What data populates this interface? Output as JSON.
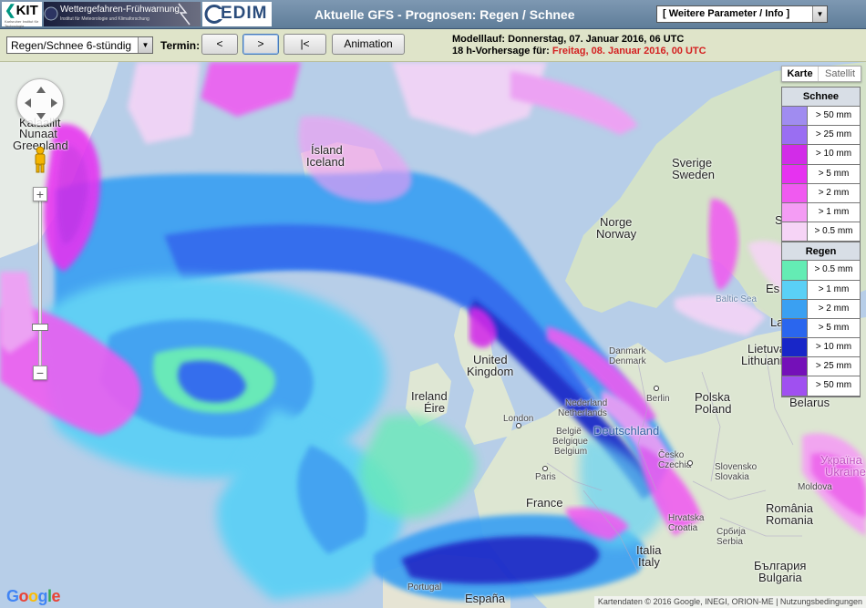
{
  "header": {
    "logo_kit": "KIT",
    "logo_kit_sub": "Karlsruher Institut für Technologie",
    "logo_wett_title": "Wettergefahren-Frühwarnung",
    "logo_wett_sub": "Institut für Meteorologie und Klimaforschung",
    "logo_cedim": "EDIM",
    "title": "Aktuelle GFS - Prognosen: Regen / Schnee",
    "param_select": "[ Weitere Parameter / Info ]"
  },
  "toolbar": {
    "product_select": "Regen/Schnee 6-stündig",
    "termin_label": "Termin:",
    "prev_label": "<",
    "next_label": ">",
    "first_label": "|<",
    "animation_label": "Animation",
    "run_line": "Modelllauf: Donnerstag, 07. Januar 2016, 06 UTC",
    "forecast_prefix": "18 h-Vorhersage für:",
    "forecast_time": "Freitag, 08. Januar 2016, 00 UTC"
  },
  "map": {
    "maptype_karte": "Karte",
    "maptype_satellit": "Satellit",
    "labels": {
      "kalaallit": "Kalaallit",
      "nunaat": "Nunaat",
      "greenland": "Greenland",
      "island": "Ísland",
      "iceland": "Iceland",
      "sverige": "Sverige",
      "sweden": "Sweden",
      "norge": "Norge",
      "norway": "Norway",
      "baltic": "Baltic Sea",
      "danmark": "Danmark",
      "denmark": "Denmark",
      "united": "United",
      "kingdom": "Kingdom",
      "ireland": "Ireland",
      "eire": "Éire",
      "london": "London",
      "nederland": "Nederland",
      "netherlands": "Netherlands",
      "belgie": "België",
      "belgique": "Belgique",
      "belgium": "Belgium",
      "paris": "Paris",
      "france": "France",
      "deutschland": "Deutschland",
      "berlin": "Berlin",
      "polska": "Polska",
      "poland": "Poland",
      "lietuva": "Lietuva",
      "lithuania": "Lithuania",
      "belarus": "Belarus",
      "cesko": "Česko",
      "czechia": "Czechia",
      "slovensko": "Slovensko",
      "slovakia": "Slovakia",
      "ukraine": "Україна",
      "ukraine2": "Ukraine",
      "moldova": "Moldova",
      "romania": "România",
      "romania2": "Romania",
      "hrvatska": "Hrvatska",
      "croatia": "Croatia",
      "srbija": "Србија",
      "serbia": "Serbia",
      "italia": "Italia",
      "italy": "Italy",
      "bulgaria": "България",
      "bulgaria2": "Bulgaria",
      "portugal": "Portugal",
      "espana": "España",
      "es_partial": "Es",
      "la_partial": "La",
      "s_partial": "S"
    },
    "google": "Google",
    "attribution": "Kartendaten © 2016 Google, INEGI, ORION-ME | Nutzungsbedingungen"
  },
  "legend": {
    "snow_title": "Schnee",
    "snow": [
      {
        "label": "> 50 mm",
        "color": "#a08cf0"
      },
      {
        "label": "> 25 mm",
        "color": "#9a6ef2"
      },
      {
        "label": "> 10 mm",
        "color": "#d22ce8"
      },
      {
        "label": "> 5 mm",
        "color": "#e632f0"
      },
      {
        "label": "> 2 mm",
        "color": "#f05af0"
      },
      {
        "label": "> 1 mm",
        "color": "#f49cf4"
      },
      {
        "label": "> 0.5 mm",
        "color": "#f6d4f6"
      }
    ],
    "rain_title": "Regen",
    "rain": [
      {
        "label": "> 0.5 mm",
        "color": "#64ecb4"
      },
      {
        "label": "> 1 mm",
        "color": "#5ad0f6"
      },
      {
        "label": "> 2 mm",
        "color": "#3aa0f2"
      },
      {
        "label": "> 5 mm",
        "color": "#2a66ee"
      },
      {
        "label": "> 10 mm",
        "color": "#1826c8"
      },
      {
        "label": "> 25 mm",
        "color": "#7410b8"
      },
      {
        "label": "> 50 mm",
        "color": "#a050f0"
      }
    ]
  }
}
